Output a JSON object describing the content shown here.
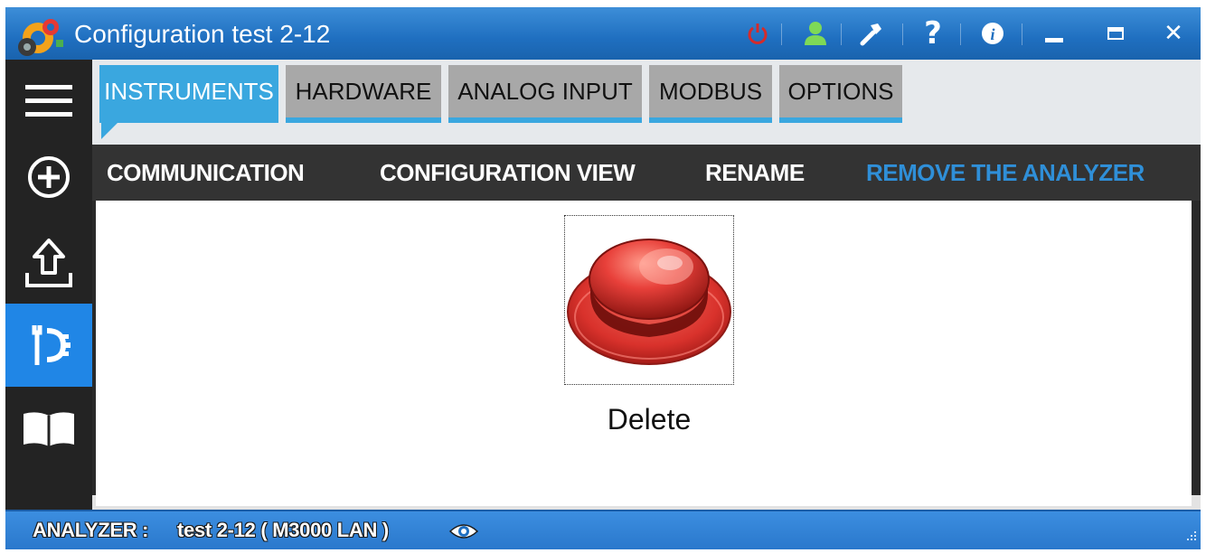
{
  "window": {
    "title": "Configuration test 2-12",
    "icons": [
      "power-icon",
      "user-icon",
      "wrench-icon",
      "help-icon",
      "info-icon",
      "minimize-icon",
      "maximize-icon",
      "close-icon"
    ]
  },
  "sidebar": {
    "items": [
      {
        "name": "menu",
        "icon": "hamburger-menu-icon"
      },
      {
        "name": "add",
        "icon": "plus-circle-icon"
      },
      {
        "name": "upload",
        "icon": "upload-icon"
      },
      {
        "name": "configuration",
        "icon": "tools-gear-icon",
        "active": true
      },
      {
        "name": "manual",
        "icon": "book-icon"
      }
    ]
  },
  "tabs": [
    {
      "label": "INSTRUMENTS",
      "active": true
    },
    {
      "label": "HARDWARE",
      "active": false
    },
    {
      "label": "ANALOG INPUT",
      "active": false
    },
    {
      "label": "MODBUS",
      "active": false
    },
    {
      "label": "OPTIONS",
      "active": false
    }
  ],
  "commands": [
    {
      "label": "COMMUNICATION",
      "active": false
    },
    {
      "label": "CONFIGURATION VIEW",
      "active": false
    },
    {
      "label": "RENAME",
      "active": false
    },
    {
      "label": "REMOVE THE ANALYZER",
      "active": true
    }
  ],
  "content": {
    "delete_label": "Delete",
    "delete_icon": "red-push-button-icon"
  },
  "status": {
    "label": "ANALYZER :",
    "value": "test 2-12 ( M3000 LAN )",
    "icon": "eye-icon"
  },
  "colors": {
    "titlebar": "#1f6fc0",
    "accent": "#3aa7df",
    "sidebar": "#232323",
    "sidebar_active": "#2086e6",
    "command_active": "#2f8fd8",
    "delete_button": "#d9322c"
  }
}
